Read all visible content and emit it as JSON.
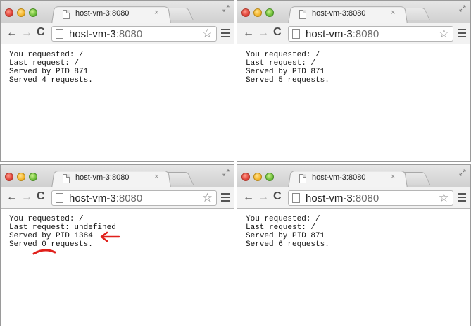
{
  "windows": [
    {
      "tab_title": "host-vm-3:8080",
      "tab_close": "×",
      "url_host": "host-vm-3",
      "url_port": ":8080",
      "lines": [
        "You requested: /",
        "Last request: /",
        "Served by PID 871",
        "Served 4 requests."
      ]
    },
    {
      "tab_title": "host-vm-3:8080",
      "tab_close": "×",
      "url_host": "host-vm-3",
      "url_port": ":8080",
      "lines": [
        "You requested: /",
        "Last request: /",
        "Served by PID 871",
        "Served 5 requests."
      ]
    },
    {
      "tab_title": "host-vm-3:8080",
      "tab_close": "×",
      "url_host": "host-vm-3",
      "url_port": ":8080",
      "lines": [
        "You requested: /",
        "Last request: undefined",
        "Served by PID 1384",
        "Served 0 requests."
      ]
    },
    {
      "tab_title": "host-vm-3:8080",
      "tab_close": "×",
      "url_host": "host-vm-3",
      "url_port": ":8080",
      "lines": [
        "You requested: /",
        "Last request: /",
        "Served by PID 871",
        "Served 6 requests."
      ]
    }
  ],
  "toolbar": {
    "back_glyph": "←",
    "forward_glyph": "→",
    "reload_glyph": "C",
    "star_glyph": "☆"
  },
  "colors": {
    "annotation": "#e0201b"
  }
}
